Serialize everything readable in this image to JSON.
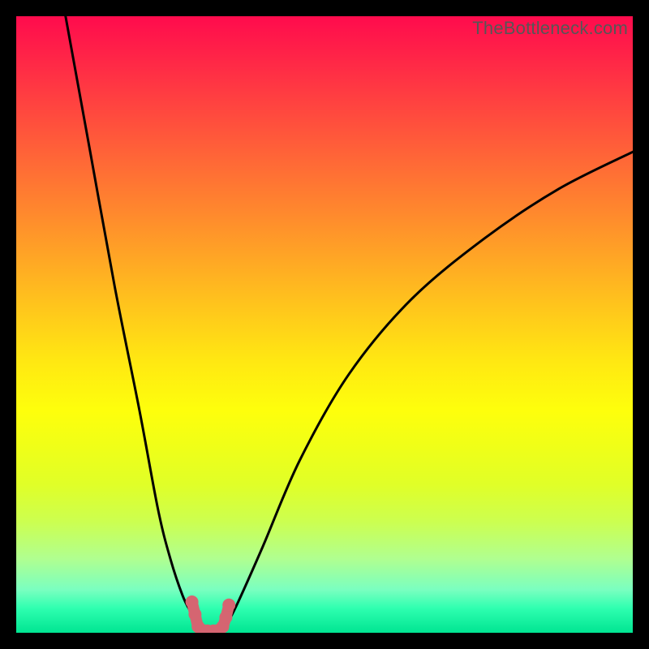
{
  "watermark": "TheBottleneck.com",
  "colors": {
    "curve": "#000000",
    "marker": "#d56571",
    "frame": "#000000"
  },
  "chart_data": {
    "type": "line",
    "title": "",
    "xlabel": "",
    "ylabel": "",
    "xlim": [
      0,
      100
    ],
    "ylim": [
      0,
      100
    ],
    "grid": false,
    "legend": false,
    "annotations": [],
    "series": [
      {
        "name": "left-branch",
        "x": [
          8,
          12,
          16,
          20,
          23,
          25,
          27,
          28.5,
          29.5
        ],
        "y": [
          100,
          78,
          56,
          36,
          20,
          12,
          6,
          3,
          1
        ],
        "stroke": "#000000"
      },
      {
        "name": "right-branch",
        "x": [
          34,
          36,
          40,
          46,
          54,
          64,
          76,
          88,
          100
        ],
        "y": [
          1,
          5,
          14,
          28,
          42,
          54,
          64,
          72,
          78
        ],
        "stroke": "#000000"
      },
      {
        "name": "trough-marker",
        "x": [
          28.5,
          29,
          29.5,
          30,
          31,
          32,
          33,
          33.5,
          34,
          34.5
        ],
        "y": [
          5,
          3,
          1,
          0.5,
          0.3,
          0.3,
          0.5,
          1,
          2.5,
          4.5
        ],
        "stroke": "#d56571",
        "style": "thick-dots"
      }
    ]
  }
}
